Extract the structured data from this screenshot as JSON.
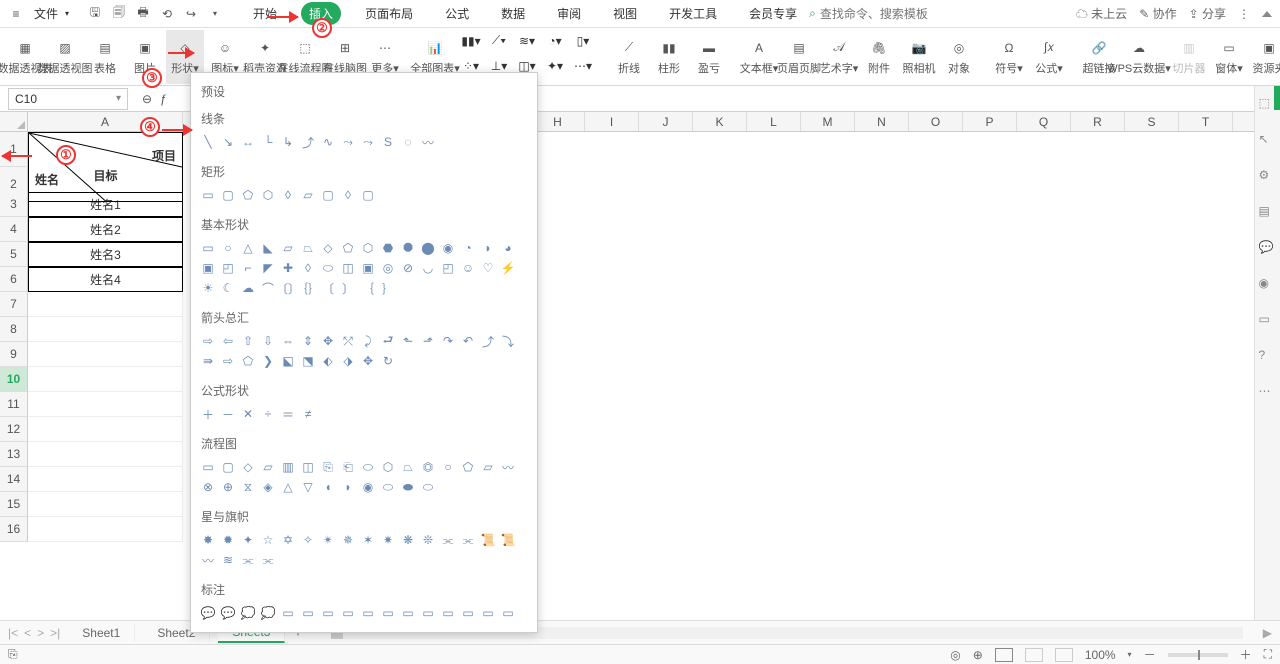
{
  "menu": {
    "file": "文件",
    "tabs": [
      "开始",
      "插入",
      "页面布局",
      "公式",
      "数据",
      "审阅",
      "视图",
      "开发工具",
      "会员专享"
    ],
    "active_tab": "插入",
    "search_placeholder": "查找命令、搜索模板",
    "cloud": "未上云",
    "collab": "协作",
    "share": "分享"
  },
  "ribbon": {
    "items": [
      {
        "label": "数据透视表"
      },
      {
        "label": "数据透视图"
      },
      {
        "label": "表格"
      },
      {
        "label": "图片"
      },
      {
        "label": "形状"
      },
      {
        "label": "图标"
      },
      {
        "label": "稻壳资源"
      },
      {
        "label": "在线流程图"
      },
      {
        "label": "在线脑图"
      },
      {
        "label": "更多"
      },
      {
        "label": "全部图表"
      },
      {
        "label": ""
      },
      {
        "label": ""
      },
      {
        "label": ""
      },
      {
        "label": ""
      },
      {
        "label": "折线"
      },
      {
        "label": "柱形"
      },
      {
        "label": "盈亏"
      },
      {
        "label": "文本框"
      },
      {
        "label": "页眉页脚"
      },
      {
        "label": "艺术字"
      },
      {
        "label": "附件"
      },
      {
        "label": "照相机"
      },
      {
        "label": "对象"
      },
      {
        "label": "符号"
      },
      {
        "label": "公式"
      },
      {
        "label": "超链接"
      },
      {
        "label": "WPS云数据"
      },
      {
        "label": "切片器"
      },
      {
        "label": "窗体"
      },
      {
        "label": "资源夹"
      }
    ]
  },
  "name_box": "C10",
  "columns": [
    "A",
    "",
    "H",
    "I",
    "J",
    "K",
    "L",
    "M",
    "N",
    "O",
    "P",
    "Q",
    "R",
    "S",
    "T"
  ],
  "cells": {
    "a_header_top": "目标",
    "a_header_right": "项目",
    "a_header_left": "姓名",
    "a_rows": [
      "姓名1",
      "姓名2",
      "姓名3",
      "姓名4"
    ]
  },
  "shapes_panel": {
    "sections": [
      "预设",
      "线条",
      "矩形",
      "基本形状",
      "箭头总汇",
      "公式形状",
      "流程图",
      "星与旗帜",
      "标注"
    ]
  },
  "sheets": [
    "Sheet1",
    "Sheet2",
    "Sheet3"
  ],
  "active_sheet": "Sheet3",
  "zoom": "100%",
  "annotations": {
    "n1": "①",
    "n2": "②",
    "n3": "③",
    "n4": "④"
  }
}
